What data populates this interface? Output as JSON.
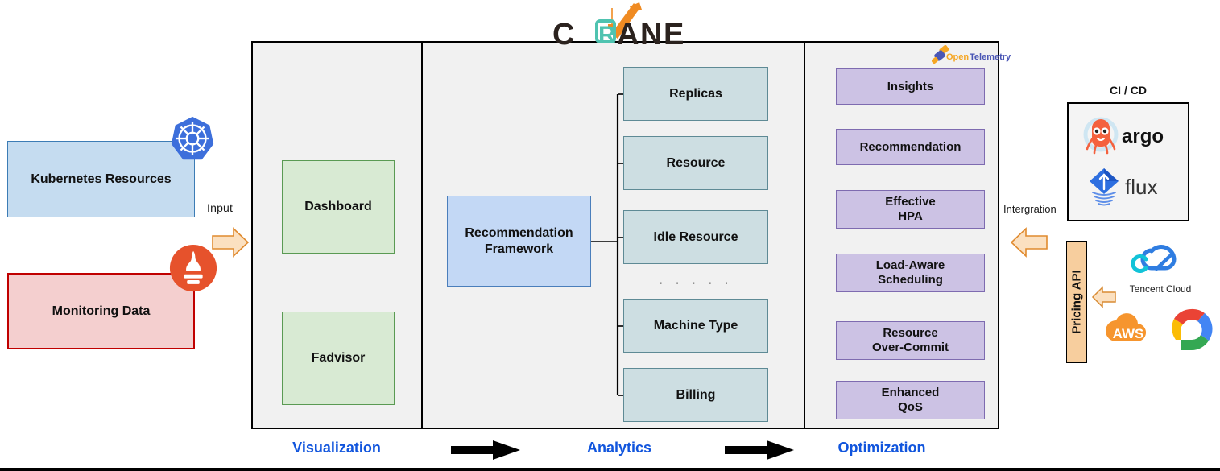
{
  "diagram": {
    "title": "CRANE",
    "logo_text": "CRANE",
    "logo_highlight_letter": "R",
    "colors": {
      "panel_bg": "#f1f1f1",
      "stage_label": "#1155dd",
      "visualization_box": "#d8ead3",
      "analytics_box": "#cddee2",
      "optimization_box": "#ccc2e4",
      "framework_box": "#c3d8f5",
      "k8s_box": "#c5dcf0",
      "monitoring_box": "#f4cfcf",
      "pricing_api_box": "#f7ce9e",
      "arrow_orange": "#f7ce9e",
      "crane_orange": "#f08b22",
      "crane_teal": "#4fc3b0"
    }
  },
  "inputs": {
    "boxes": [
      {
        "label": "Kubernetes Resources",
        "icon": "kubernetes-icon"
      },
      {
        "label": "Monitoring Data",
        "icon": "prometheus-icon"
      }
    ],
    "flow_label": "Input",
    "arrow_icon": "right-arrow-icon"
  },
  "visualization": {
    "stage_label": "Visualization",
    "boxes": [
      {
        "label": "Dashboard"
      },
      {
        "label": "Fadvisor"
      }
    ]
  },
  "analytics": {
    "stage_label": "Analytics",
    "framework": {
      "line1": "Recommendation",
      "line2": "Framework"
    },
    "outputs": [
      {
        "label": "Replicas"
      },
      {
        "label": "Resource"
      },
      {
        "label": "Idle Resource"
      },
      {
        "label": "Machine Type"
      },
      {
        "label": "Billing"
      }
    ],
    "ellipsis": "· · · · ·"
  },
  "optimization": {
    "stage_label": "Optimization",
    "boxes": [
      {
        "line1": "Insights",
        "line2": ""
      },
      {
        "line1": "Recommendation",
        "line2": ""
      },
      {
        "line1": "Effective",
        "line2": "HPA"
      },
      {
        "line1": "Load-Aware",
        "line2": "Scheduling"
      },
      {
        "line1": "Resource",
        "line2": "Over-Commit"
      },
      {
        "line1": "Enhanced",
        "line2": "QoS"
      }
    ],
    "telemetry_logo": {
      "part1": "Open",
      "part2": "Telemetry"
    }
  },
  "integration": {
    "label": "Intergration",
    "arrow_icon": "left-arrow-icon",
    "cicd": {
      "title": "CI / CD",
      "tools": [
        {
          "name": "argo",
          "icon": "argo-octopus-icon"
        },
        {
          "name": "flux",
          "icon": "flux-diamond-icon"
        }
      ]
    },
    "pricing_api": {
      "label": "Pricing API",
      "arrow_icon": "left-arrow-icon"
    },
    "clouds": [
      {
        "name": "Tencent Cloud",
        "icon": "tencent-cloud-icon"
      },
      {
        "name": "AWS",
        "icon": "aws-cloud-icon"
      },
      {
        "name": "Google Cloud",
        "icon": "google-cloud-icon"
      }
    ]
  },
  "stage_flow": {
    "arrow_icon": "thick-right-arrow-icon"
  }
}
